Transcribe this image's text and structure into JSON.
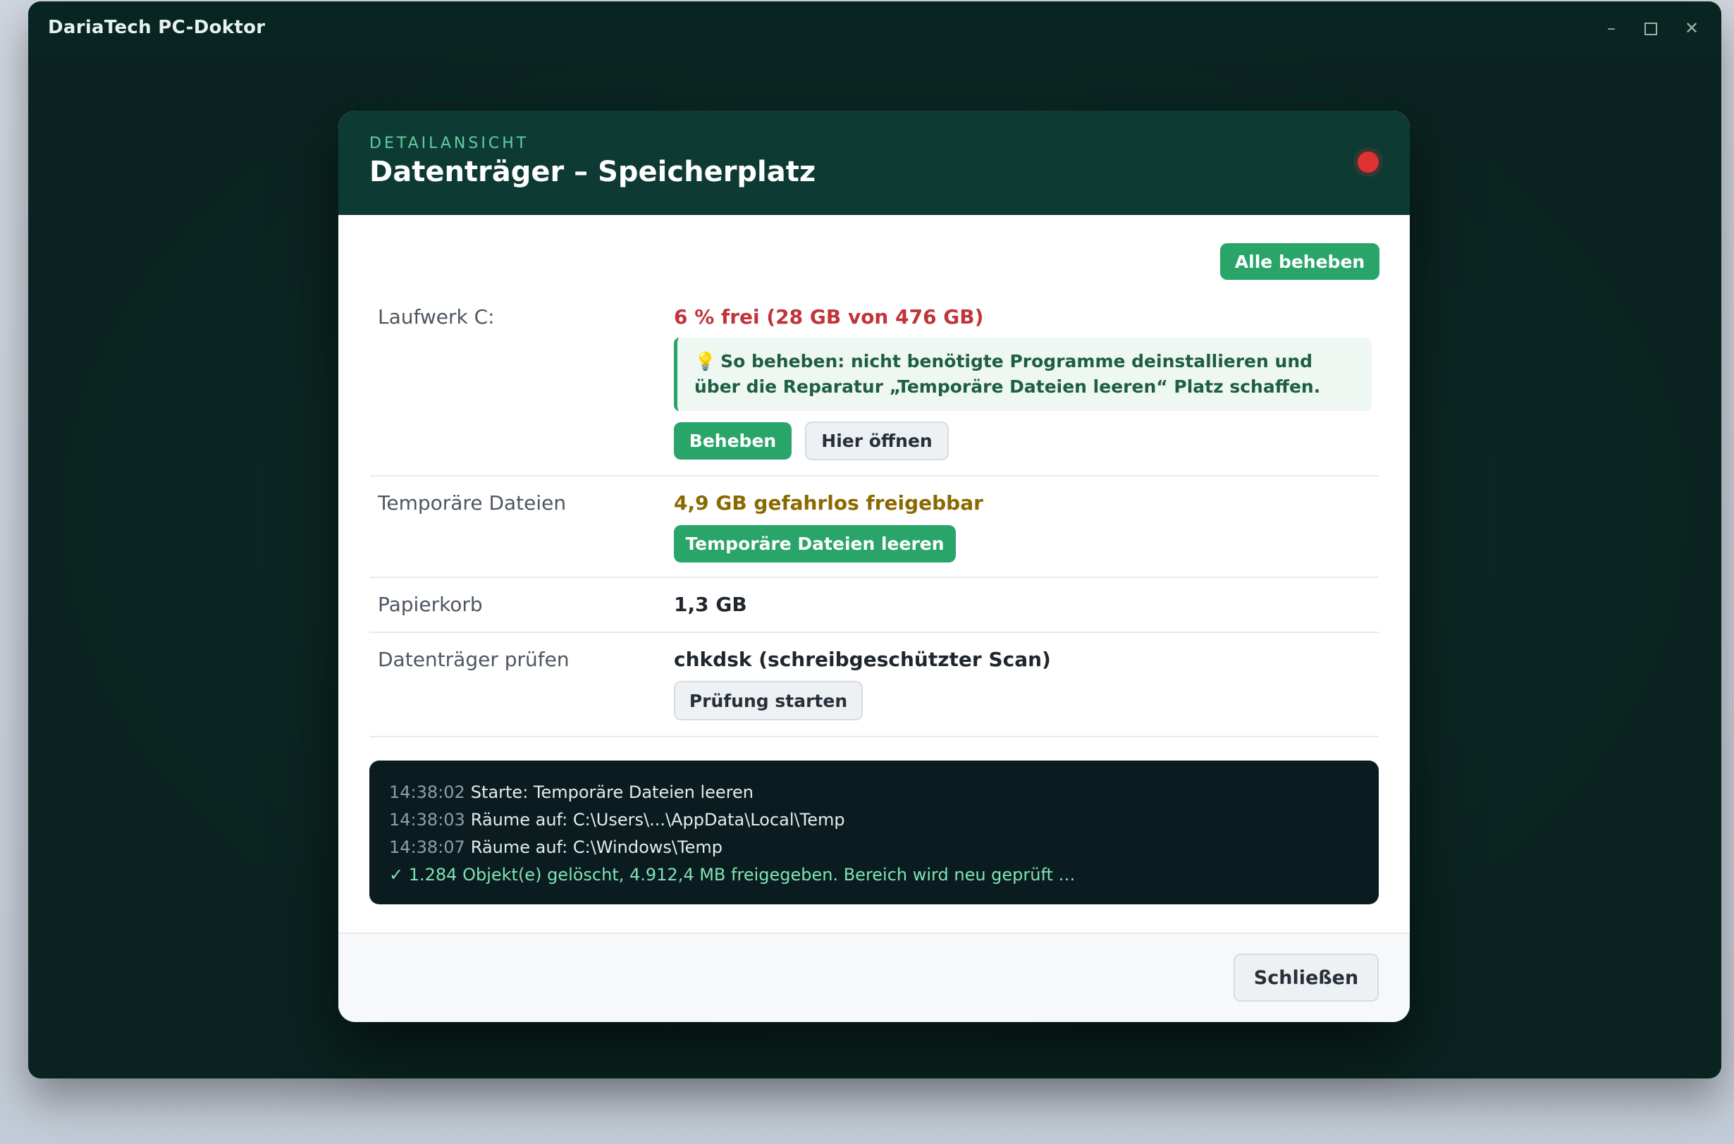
{
  "window": {
    "title": "DariaTech PC-Doktor",
    "controls": {
      "minimize": "–",
      "close": "✕"
    }
  },
  "dialog": {
    "eyebrow": "DETAILANSICHT",
    "title": "Datenträger – Speicherplatz",
    "status_color": "#e03232",
    "fix_all_label": "Alle beheben",
    "rows": [
      {
        "label": "Laufwerk C:",
        "value": "6 % frei (28 GB von 476 GB)",
        "hint_icon": "💡",
        "hint": "So beheben: nicht benötigte Programme deinstallieren und über die Reparatur „Temporäre Dateien leeren“ Platz schaffen.",
        "primary_action": "Beheben",
        "secondary_action": "Hier öffnen"
      },
      {
        "label": "Temporäre Dateien",
        "value": "4,9 GB gefahrlos freigebbar",
        "primary_action": "Temporäre Dateien leeren"
      },
      {
        "label": "Papierkorb",
        "value": "1,3 GB"
      },
      {
        "label": "Datenträger prüfen",
        "value": "chkdsk (schreibgeschützter Scan)",
        "secondary_action": "Prüfung starten"
      }
    ],
    "log": [
      {
        "time": "14:38:02",
        "text": "Starte: Temporäre Dateien leeren"
      },
      {
        "time": "14:38:03",
        "text": "Räume auf: C:\\Users\\...\\AppData\\Local\\Temp"
      },
      {
        "time": "14:38:07",
        "text": "Räume auf: C:\\Windows\\Temp"
      },
      {
        "time": "",
        "text": "✓ 1.284 Objekt(e) gelöscht, 4.912,4 MB freigegeben. Bereich wird neu geprüft …"
      }
    ],
    "close_label": "Schließen"
  },
  "colors": {
    "accent_green": "#2aa56a",
    "header_bg": "#0d3b33",
    "critical_red": "#c0343a",
    "warning_amber": "#8a6a00"
  }
}
